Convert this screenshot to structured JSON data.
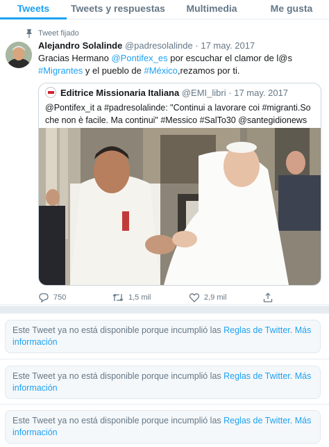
{
  "tabs": [
    {
      "label": "Tweets",
      "active": true
    },
    {
      "label": "Tweets y respuestas",
      "active": false
    },
    {
      "label": "Multimedia",
      "active": false
    },
    {
      "label": "Me gusta",
      "active": false
    }
  ],
  "pinned": {
    "label": "Tweet fijado",
    "icon": "pin-icon"
  },
  "tweet": {
    "name": "Alejandro Solalinde",
    "handle": "@padresolalinde",
    "separator": "·",
    "date": "17 may. 2017",
    "text": {
      "part1": "Gracias Hermano ",
      "mention": "@Pontifex_es",
      "part2": " por escuchar el clamor de l@s ",
      "hashtag1": "#Migrantes",
      "part3": " y el pueblo de ",
      "hashtag2": "#México",
      "part4": ",rezamos por ti."
    },
    "quote": {
      "name": "Editrice Missionaria Italiana",
      "handle": "@EMI_libri",
      "separator": "·",
      "date": "17 may. 2017",
      "text": "@Pontifex_it a #padresolalinde: \"Continui a lavorare coi #migranti.So che non è facile. Ma continui\" #Messico #SalTo30 @santegidionews"
    },
    "actions": {
      "replies": "750",
      "retweets": "1,5 mil",
      "likes": "2,9 mil"
    }
  },
  "notices": [
    {
      "text": "Este Tweet ya no está disponible porque incumplió las ",
      "link1": "Reglas de Twitter",
      "dot": ". ",
      "link2": "Más información"
    },
    {
      "text": "Este Tweet ya no está disponible porque incumplió las ",
      "link1": "Reglas de Twitter",
      "dot": ". ",
      "link2": "Más información"
    },
    {
      "text": "Este Tweet ya no está disponible porque incumplió las ",
      "link1": "Reglas de Twitter",
      "dot": ". ",
      "link2": "Más información"
    }
  ],
  "colors": {
    "accent": "#1da1f2",
    "secondary_text": "#657786",
    "border": "#e6ecf0"
  }
}
